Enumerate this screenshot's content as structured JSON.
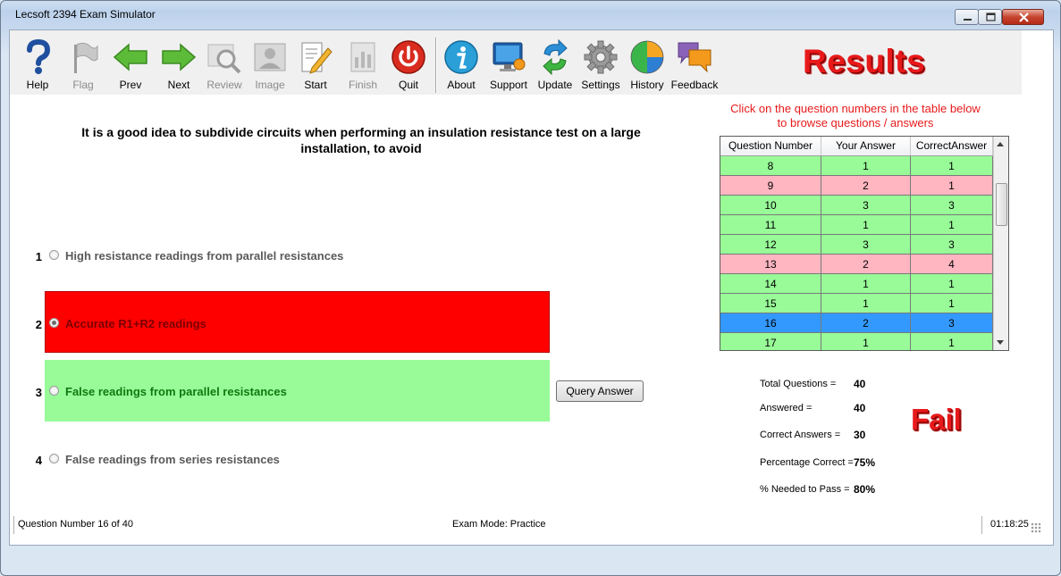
{
  "window": {
    "title": "Lecsoft 2394 Exam Simulator"
  },
  "toolbar": {
    "items": [
      {
        "label": "Help",
        "icon": "help-icon",
        "enabled": true
      },
      {
        "label": "Flag",
        "icon": "flag-icon",
        "enabled": false
      },
      {
        "label": "Prev",
        "icon": "arrow-left-icon",
        "enabled": true
      },
      {
        "label": "Next",
        "icon": "arrow-right-icon",
        "enabled": true
      },
      {
        "label": "Review",
        "icon": "magnifier-icon",
        "enabled": false
      },
      {
        "label": "Image",
        "icon": "image-icon",
        "enabled": false
      },
      {
        "label": "Start",
        "icon": "start-pencil-icon",
        "enabled": true
      },
      {
        "label": "Finish",
        "icon": "finish-icon",
        "enabled": false
      },
      {
        "label": "Quit",
        "icon": "power-icon",
        "enabled": true
      },
      {
        "label": "About",
        "icon": "info-icon",
        "enabled": true
      },
      {
        "label": "Support",
        "icon": "support-monitor-icon",
        "enabled": true
      },
      {
        "label": "Update",
        "icon": "update-arrows-icon",
        "enabled": true
      },
      {
        "label": "Settings",
        "icon": "gear-icon",
        "enabled": true
      },
      {
        "label": "History",
        "icon": "pie-chart-icon",
        "enabled": true
      },
      {
        "label": "Feedback",
        "icon": "chat-bubbles-icon",
        "enabled": true
      }
    ]
  },
  "results": {
    "title": "Results",
    "hint_line1": "Click on the question numbers in the table below",
    "hint_line2": "to browse questions / answers"
  },
  "question": {
    "text": "It is a good idea to subdivide circuits when performing an insulation resistance test on a large installation, to avoid",
    "options": [
      {
        "num": "1",
        "text": "High resistance readings from parallel resistances",
        "state": "neutral",
        "selected": false
      },
      {
        "num": "2",
        "text": "Accurate R1+R2 readings",
        "state": "wrong",
        "selected": true
      },
      {
        "num": "3",
        "text": "False readings from parallel resistances",
        "state": "correct",
        "selected": false
      },
      {
        "num": "4",
        "text": "False readings from series resistances",
        "state": "neutral",
        "selected": false
      }
    ],
    "query_button": "Query Answer"
  },
  "table": {
    "headers": [
      "Question Number",
      "Your Answer",
      "CorrectAnswer"
    ],
    "rows": [
      {
        "q": "8",
        "yours": "1",
        "correct": "1",
        "status": "green"
      },
      {
        "q": "9",
        "yours": "2",
        "correct": "1",
        "status": "pink"
      },
      {
        "q": "10",
        "yours": "3",
        "correct": "3",
        "status": "green"
      },
      {
        "q": "11",
        "yours": "1",
        "correct": "1",
        "status": "green"
      },
      {
        "q": "12",
        "yours": "3",
        "correct": "3",
        "status": "green"
      },
      {
        "q": "13",
        "yours": "2",
        "correct": "4",
        "status": "pink"
      },
      {
        "q": "14",
        "yours": "1",
        "correct": "1",
        "status": "green"
      },
      {
        "q": "15",
        "yours": "1",
        "correct": "1",
        "status": "green"
      },
      {
        "q": "16",
        "yours": "2",
        "correct": "3",
        "status": "sel"
      },
      {
        "q": "17",
        "yours": "1",
        "correct": "1",
        "status": "green"
      }
    ]
  },
  "stats": {
    "total_label": "Total Questions =",
    "total_value": "40",
    "answered_label": "Answered =",
    "answered_value": "40",
    "correct_label": "Correct Answers =",
    "correct_value": "30",
    "pct_label": "Percentage Correct =",
    "pct_value": "75%",
    "needed_label": "% Needed to Pass =",
    "needed_value": "80%",
    "verdict": "Fail"
  },
  "status": {
    "question": "Question Number 16 of 40",
    "mode": "Exam Mode: Practice",
    "time": "01:18:25"
  },
  "colors": {
    "accent_red": "#e8191a",
    "wrong_fill": "#ff0000",
    "correct_fill": "#98fb98",
    "row_pink": "#ffb6c1",
    "row_selected": "#3399ff"
  }
}
